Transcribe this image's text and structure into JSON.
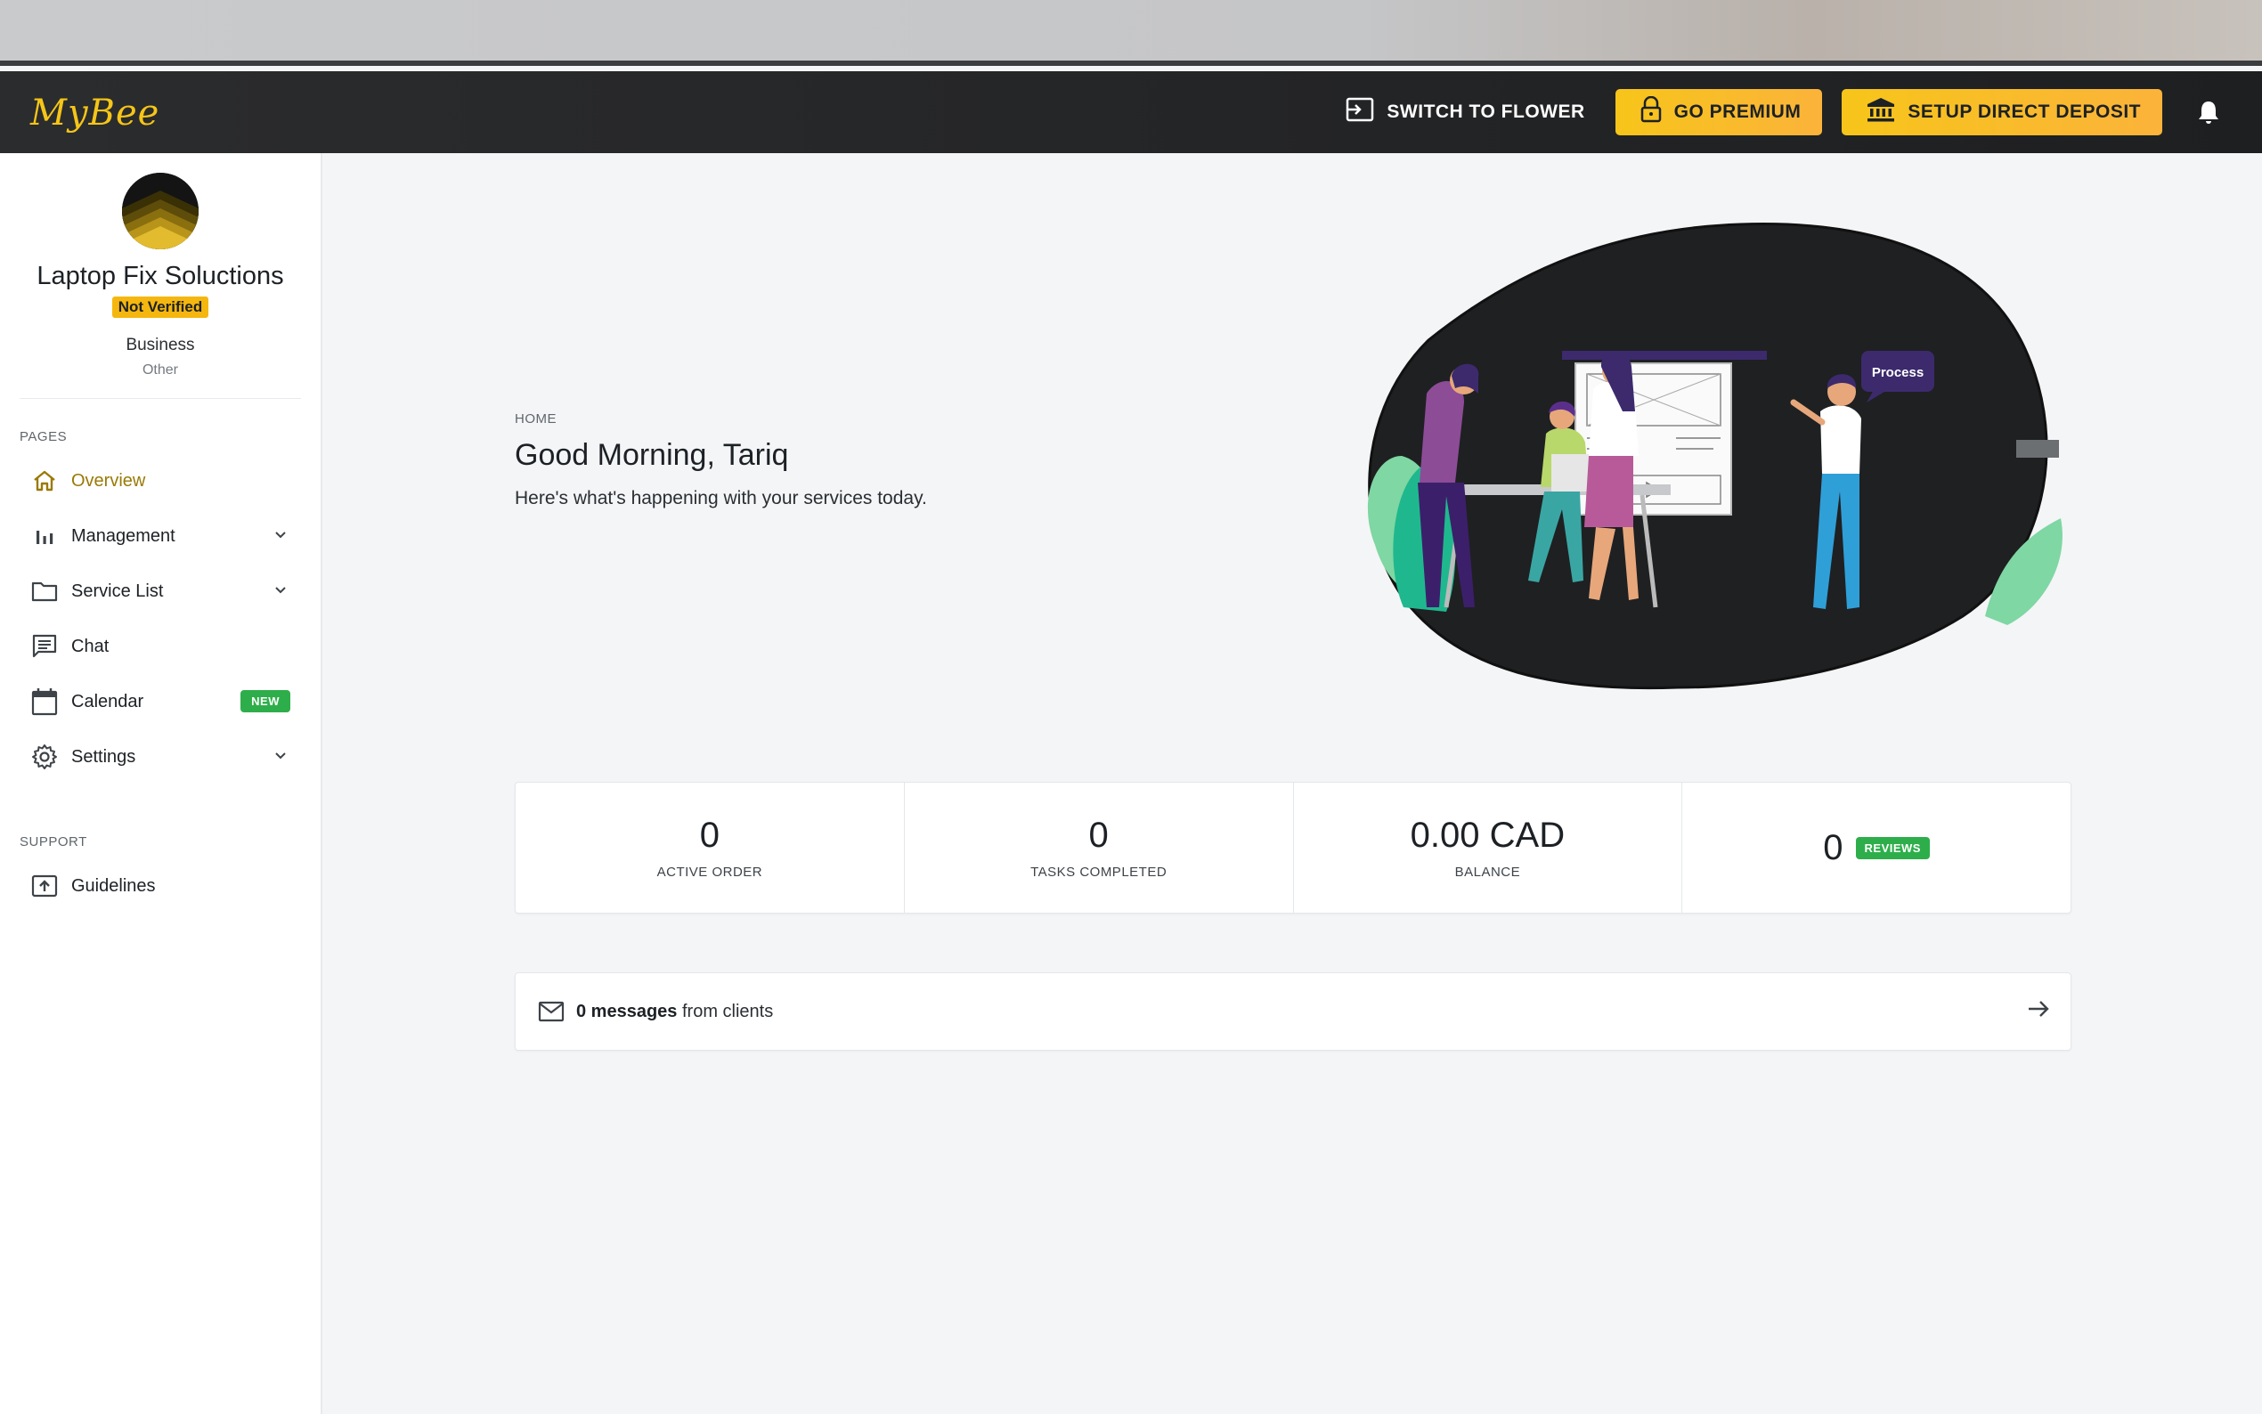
{
  "app": {
    "logo": "MyBee"
  },
  "topbar": {
    "switch_label": "SWITCH TO FLOWER",
    "premium_label": "GO PREMIUM",
    "deposit_label": "SETUP DIRECT DEPOSIT"
  },
  "profile": {
    "company": "Laptop Fix Soluctions",
    "verification": "Not Verified",
    "type": "Business",
    "subtype": "Other"
  },
  "sidebar": {
    "pages_label": "PAGES",
    "support_label": "SUPPORT",
    "items": [
      {
        "label": "Overview",
        "icon": "home-icon",
        "active": true
      },
      {
        "label": "Management",
        "icon": "bar-chart-icon"
      },
      {
        "label": "Service List",
        "icon": "folder-icon"
      },
      {
        "label": "Chat",
        "icon": "chat-icon"
      },
      {
        "label": "Calendar",
        "icon": "calendar-icon",
        "badge": "NEW"
      },
      {
        "label": "Settings",
        "icon": "gear-icon"
      }
    ],
    "support_items": [
      {
        "label": "Guidelines",
        "icon": "guidelines-icon"
      }
    ]
  },
  "main": {
    "breadcrumb": "HOME",
    "greeting": "Good Morning, Tariq",
    "subline": "Here's what's happening with your services today.",
    "hero_bubble": "Process"
  },
  "stats": [
    {
      "value": "0",
      "label": "ACTIVE ORDER"
    },
    {
      "value": "0",
      "label": "TASKS COMPLETED"
    },
    {
      "value": "0.00 CAD",
      "label": "BALANCE"
    },
    {
      "value": "0",
      "badge": "REVIEWS"
    }
  ],
  "messages": {
    "count_text": "0 messages",
    "suffix": "from clients"
  },
  "colors": {
    "accent_gold": "#f5c518",
    "active_nav": "#9a7a05",
    "success_green": "#2eae4a",
    "topbar_bg": "#1e1f21"
  }
}
